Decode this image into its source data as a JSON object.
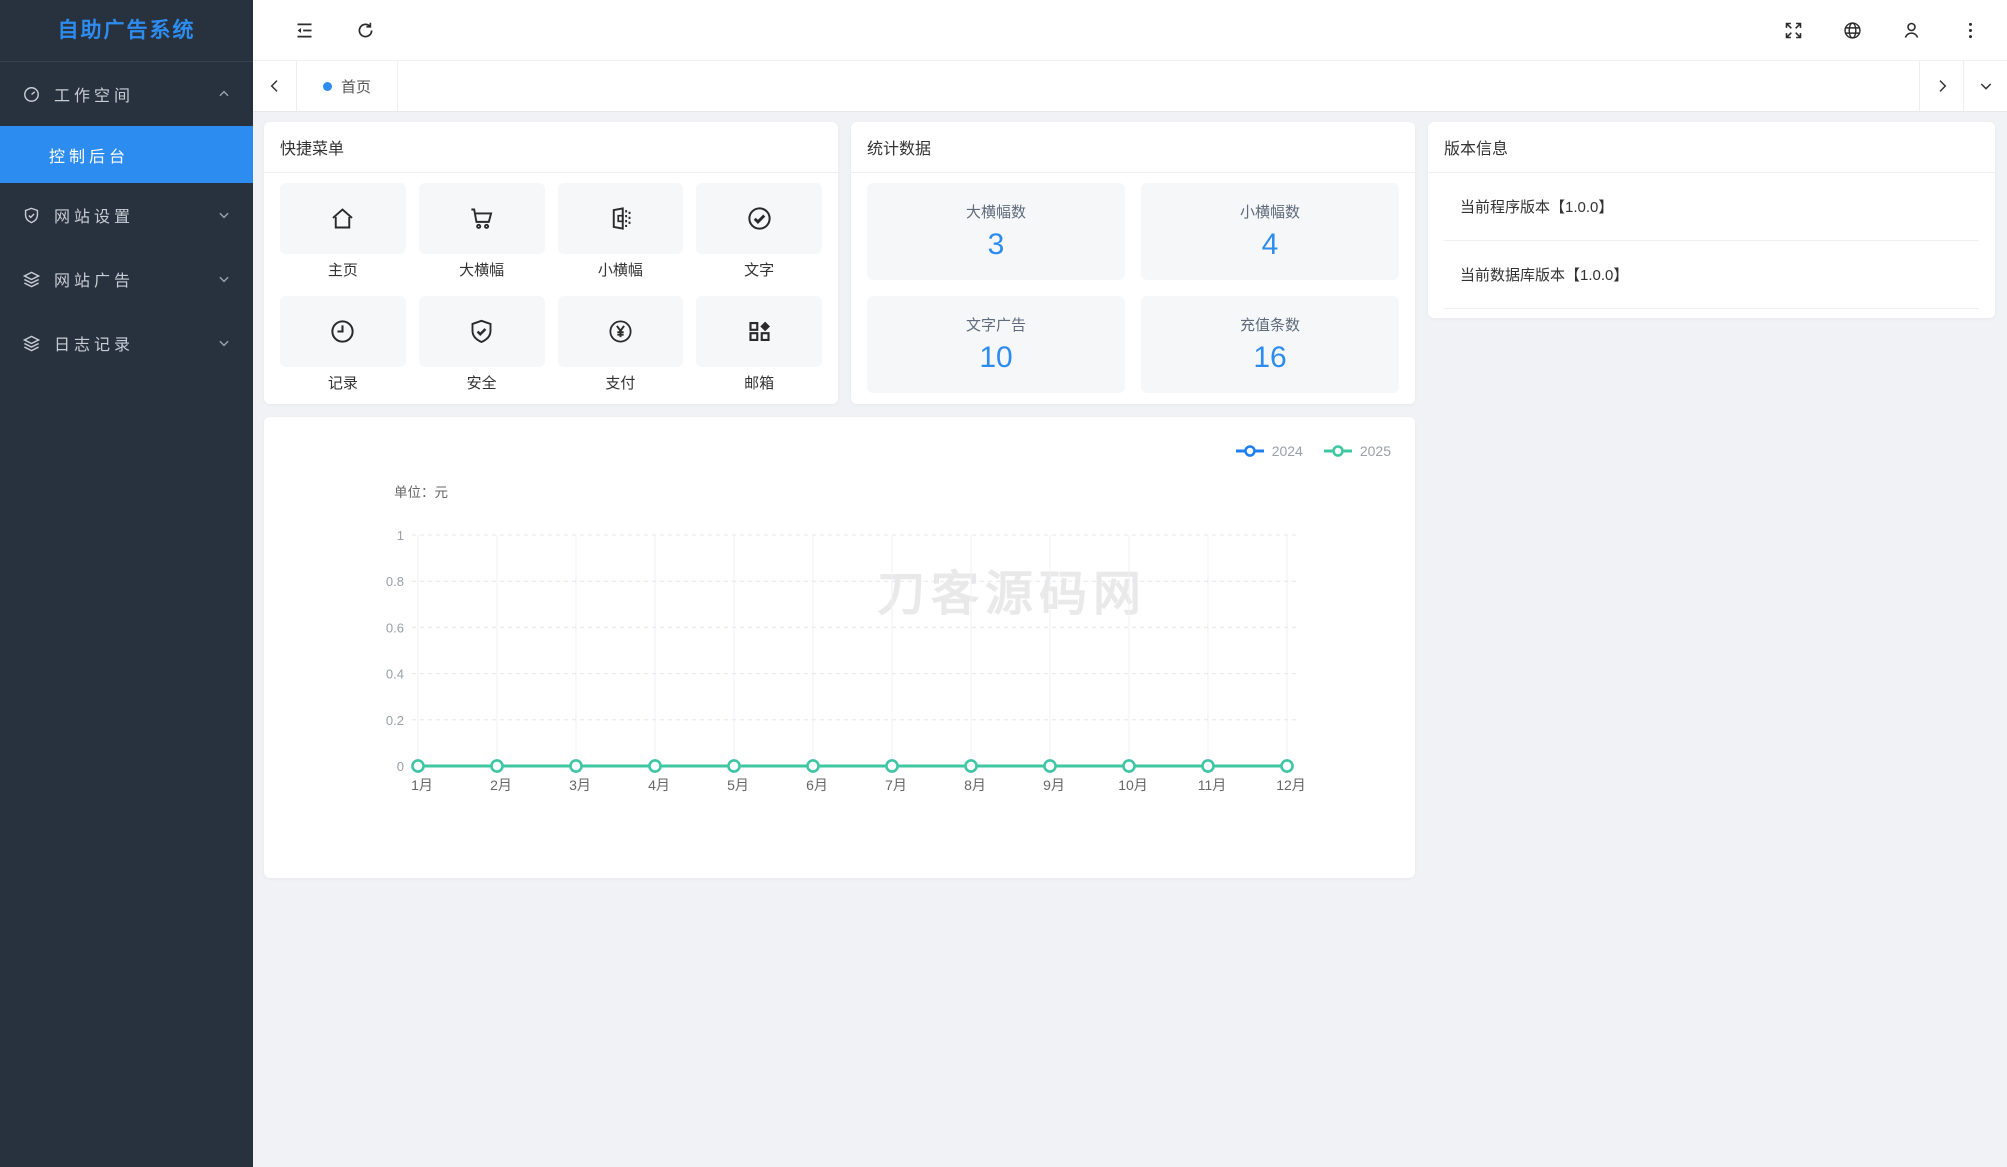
{
  "colors": {
    "accent": "#2d8cf0",
    "sidebar_bg": "#28323e",
    "content_bg": "#f0f2f5"
  },
  "app": {
    "title": "自助广告系统"
  },
  "sidebar": {
    "items": [
      {
        "label": "工作空间",
        "icon": "gauge-icon",
        "expanded": true
      },
      {
        "label": "控制后台",
        "active": true
      },
      {
        "label": "网站设置",
        "icon": "shield-icon"
      },
      {
        "label": "网站广告",
        "icon": "layers-icon"
      },
      {
        "label": "日志记录",
        "icon": "layers-icon"
      }
    ]
  },
  "header": {
    "icons": [
      "menu-fold",
      "refresh",
      "fullscreen",
      "globe",
      "user",
      "more-dots"
    ]
  },
  "tabbar": {
    "active_tab": "首页"
  },
  "quick_menu": {
    "title": "快捷菜单",
    "items": [
      {
        "label": "主页",
        "icon": "home-icon"
      },
      {
        "label": "大横幅",
        "icon": "cart-icon"
      },
      {
        "label": "小横幅",
        "icon": "banner-panel-icon"
      },
      {
        "label": "文字",
        "icon": "check-circle-icon"
      },
      {
        "label": "记录",
        "icon": "clock-icon"
      },
      {
        "label": "安全",
        "icon": "shield-check-icon"
      },
      {
        "label": "支付",
        "icon": "yen-circle-icon"
      },
      {
        "label": "邮箱",
        "icon": "grid-diamond-icon"
      }
    ]
  },
  "stats": {
    "title": "统计数据",
    "items": [
      {
        "label": "大横幅数",
        "value": "3"
      },
      {
        "label": "小横幅数",
        "value": "4"
      },
      {
        "label": "文字广告",
        "value": "10"
      },
      {
        "label": "充值条数",
        "value": "16"
      }
    ]
  },
  "version": {
    "title": "版本信息",
    "items": [
      {
        "text": "当前程序版本【1.0.0】"
      },
      {
        "text": "当前数据库版本【1.0.0】"
      }
    ]
  },
  "watermark": "刀客源码网",
  "chart_data": {
    "type": "line",
    "unit_label": "单位：元",
    "categories": [
      "1月",
      "2月",
      "3月",
      "4月",
      "5月",
      "6月",
      "7月",
      "8月",
      "9月",
      "10月",
      "11月",
      "12月"
    ],
    "series": [
      {
        "name": "2024",
        "color": "#1e7ff2",
        "values": [
          0,
          0,
          0,
          0,
          0,
          0,
          0,
          0,
          0,
          0,
          0,
          0
        ]
      },
      {
        "name": "2025",
        "color": "#3ec7a2",
        "values": [
          0,
          0,
          0,
          0,
          0,
          0,
          0,
          0,
          0,
          0,
          0,
          0
        ]
      }
    ],
    "ylim": [
      0,
      1
    ],
    "yticks": [
      0,
      0.2,
      0.4,
      0.6,
      0.8,
      1
    ],
    "grid": true,
    "legend_position": "top-right"
  }
}
